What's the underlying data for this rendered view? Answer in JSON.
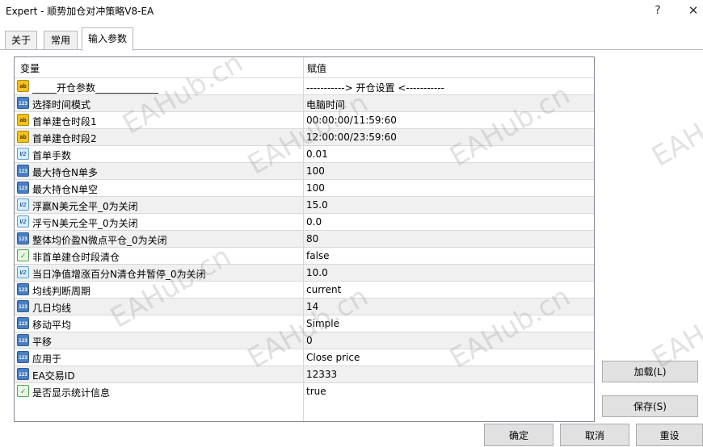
{
  "window": {
    "title": "Expert - 顺势加仓对冲策略V8-EA",
    "help_glyph": "?",
    "close_glyph": "✕"
  },
  "tabs": [
    {
      "label": "关于",
      "active": false
    },
    {
      "label": "常用",
      "active": false
    },
    {
      "label": "输入参数",
      "active": true
    }
  ],
  "grid": {
    "col_variable": "变量",
    "col_value": "赋值",
    "rows": [
      {
        "icon": "string-icon",
        "name": "_____开仓参数_____________",
        "value": "-----------> 开仓设置 <-----------"
      },
      {
        "icon": "enum-icon",
        "name": "选择时间模式",
        "value": "电脑时间"
      },
      {
        "icon": "string-icon",
        "name": "首单建仓时段1",
        "value": "00:00:00/11:59:60"
      },
      {
        "icon": "string-icon",
        "name": "首单建仓时段2",
        "value": "12:00:00/23:59:60"
      },
      {
        "icon": "double-icon",
        "name": "首单手数",
        "value": "0.01"
      },
      {
        "icon": "enum-icon",
        "name": "最大持仓N单多",
        "value": "100"
      },
      {
        "icon": "enum-icon",
        "name": "最大持仓N单空",
        "value": "100"
      },
      {
        "icon": "double-icon",
        "name": "浮赢N美元全平_0为关闭",
        "value": "15.0"
      },
      {
        "icon": "double-icon",
        "name": "浮亏N美元全平_0为关闭",
        "value": "0.0"
      },
      {
        "icon": "enum-icon",
        "name": "整体均价盈N微点平仓_0为关闭",
        "value": "80"
      },
      {
        "icon": "bool-icon",
        "name": "非首单建仓时段清仓",
        "value": "false"
      },
      {
        "icon": "double-icon",
        "name": "当日净值增涨百分N清仓并暂停_0为关闭",
        "value": "10.0"
      },
      {
        "icon": "enum-icon",
        "name": "均线判断周期",
        "value": "current"
      },
      {
        "icon": "enum-icon",
        "name": "几日均线",
        "value": "14"
      },
      {
        "icon": "enum-icon",
        "name": "移动平均",
        "value": "Simple"
      },
      {
        "icon": "enum-icon",
        "name": "平移",
        "value": "0"
      },
      {
        "icon": "enum-icon",
        "name": "应用于",
        "value": "Close price"
      },
      {
        "icon": "enum-icon",
        "name": "EA交易ID",
        "value": "12333"
      },
      {
        "icon": "bool-icon",
        "name": "是否显示统计信息",
        "value": "true"
      }
    ]
  },
  "buttons": {
    "load": "加载(L)",
    "save": "保存(S)",
    "ok": "确定",
    "cancel": "取消",
    "reset": "重设"
  },
  "watermark": "EAHub.cn"
}
